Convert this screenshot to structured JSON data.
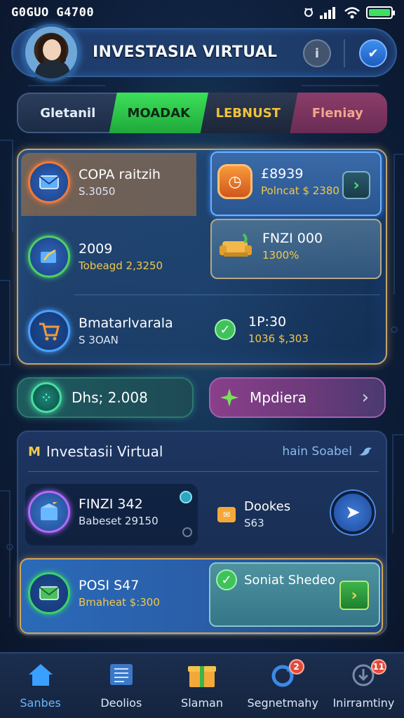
{
  "status_bar": {
    "time": "G0GUO G4700"
  },
  "header": {
    "title": "INVESTASIA VIRTUAL"
  },
  "tabs": [
    "Gletanil",
    "MOADAK",
    "LEBNUST",
    "Fleniay"
  ],
  "main_panel": {
    "items": [
      {
        "title": "COPA raitzih",
        "subtitle": "S.3050"
      },
      {
        "title": "2009",
        "subtitle": "Tobeagd 2,3250"
      },
      {
        "title": "Bmatarlvarala",
        "subtitle": "S 3OAN"
      }
    ],
    "right_items": [
      {
        "title": "£8939",
        "subtitle": "Polncat $ 2380"
      },
      {
        "title": "FNZI 000",
        "subtitle": "1300%"
      },
      {
        "title": "1P:30",
        "subtitle": "1036 $,303"
      }
    ]
  },
  "pills": {
    "left": "Dhs; 2.008",
    "right": "Mpdiera"
  },
  "bottom_panel": {
    "title": "Investasii Virtual",
    "link": "hain Soabel",
    "items": [
      {
        "title": "FINZI 342",
        "subtitle": "Babeset 29150"
      },
      {
        "title": "Dookes",
        "subtitle": "S63"
      },
      {
        "title": "POSI S47",
        "subtitle": "Bmaheat $:300"
      },
      {
        "title": "Soniat Shedeo"
      }
    ]
  },
  "nav": [
    {
      "label": "Sanbes",
      "badge": ""
    },
    {
      "label": "Deolios",
      "badge": ""
    },
    {
      "label": "Slaman",
      "badge": ""
    },
    {
      "label": "Segnetmahy",
      "badge": "2"
    },
    {
      "label": "Inirramtiny",
      "badge": "11"
    }
  ],
  "colors": {
    "accent_green": "#3de05a",
    "accent_gold": "#f2c84a",
    "accent_blue": "#4aa0ff",
    "battery": "#3fe060"
  },
  "battery_level": 1.0,
  "icons": {
    "wifi": "wifi-icon",
    "signal": "signal-icon",
    "info": "info-icon",
    "check": "check-icon"
  }
}
